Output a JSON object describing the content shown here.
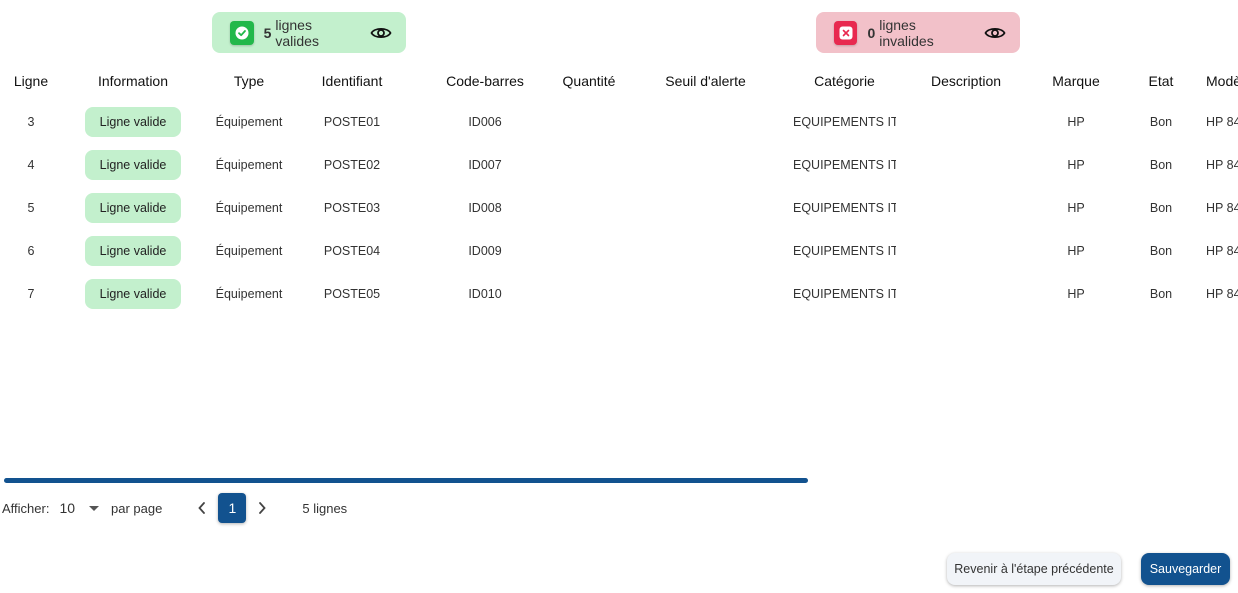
{
  "summary": {
    "valid": {
      "count": "5",
      "label": "lignes valides",
      "icon": "check-icon",
      "color": "#22b84a",
      "bg": "#c3f0cd"
    },
    "invalid": {
      "count": "0",
      "label": "lignes invalides",
      "icon": "close-icon",
      "color": "#e8294f",
      "bg": "#f2c1c9"
    }
  },
  "table": {
    "columns": [
      "Ligne",
      "Information",
      "Type",
      "Identifiant",
      "Code-barres",
      "Quantité",
      "Seuil d'alerte",
      "Catégorie",
      "Description",
      "Marque",
      "Etat",
      "Modèle"
    ],
    "rows": [
      {
        "ligne": "3",
        "information": "Ligne valide",
        "type": "Équipement",
        "identifiant": "POSTE01",
        "code_barres": "ID006",
        "quantite": "",
        "seuil": "",
        "categorie": "EQUIPEMENTS IT",
        "description": "",
        "marque": "HP",
        "etat": "Bon",
        "modele": "HP 84"
      },
      {
        "ligne": "4",
        "information": "Ligne valide",
        "type": "Équipement",
        "identifiant": "POSTE02",
        "code_barres": "ID007",
        "quantite": "",
        "seuil": "",
        "categorie": "EQUIPEMENTS IT",
        "description": "",
        "marque": "HP",
        "etat": "Bon",
        "modele": "HP 84"
      },
      {
        "ligne": "5",
        "information": "Ligne valide",
        "type": "Équipement",
        "identifiant": "POSTE03",
        "code_barres": "ID008",
        "quantite": "",
        "seuil": "",
        "categorie": "EQUIPEMENTS IT",
        "description": "",
        "marque": "HP",
        "etat": "Bon",
        "modele": "HP 84"
      },
      {
        "ligne": "6",
        "information": "Ligne valide",
        "type": "Équipement",
        "identifiant": "POSTE04",
        "code_barres": "ID009",
        "quantite": "",
        "seuil": "",
        "categorie": "EQUIPEMENTS IT",
        "description": "",
        "marque": "HP",
        "etat": "Bon",
        "modele": "HP 84"
      },
      {
        "ligne": "7",
        "information": "Ligne valide",
        "type": "Équipement",
        "identifiant": "POSTE05",
        "code_barres": "ID010",
        "quantite": "",
        "seuil": "",
        "categorie": "EQUIPEMENTS IT",
        "description": "",
        "marque": "HP",
        "etat": "Bon",
        "modele": "HP 84"
      }
    ]
  },
  "pagination": {
    "show_label": "Afficher:",
    "per_page_value": "10",
    "per_page_label": "par page",
    "prev_icon": "‹",
    "current_page": "1",
    "next_icon": "›",
    "total_label": "5 lignes"
  },
  "actions": {
    "back_label": "Revenir à l'étape précédente",
    "save_label": "Sauvegarder"
  },
  "colors": {
    "primary": "#12528f",
    "valid_bg": "#c3f0cd",
    "invalid_bg": "#f2c1c9"
  }
}
